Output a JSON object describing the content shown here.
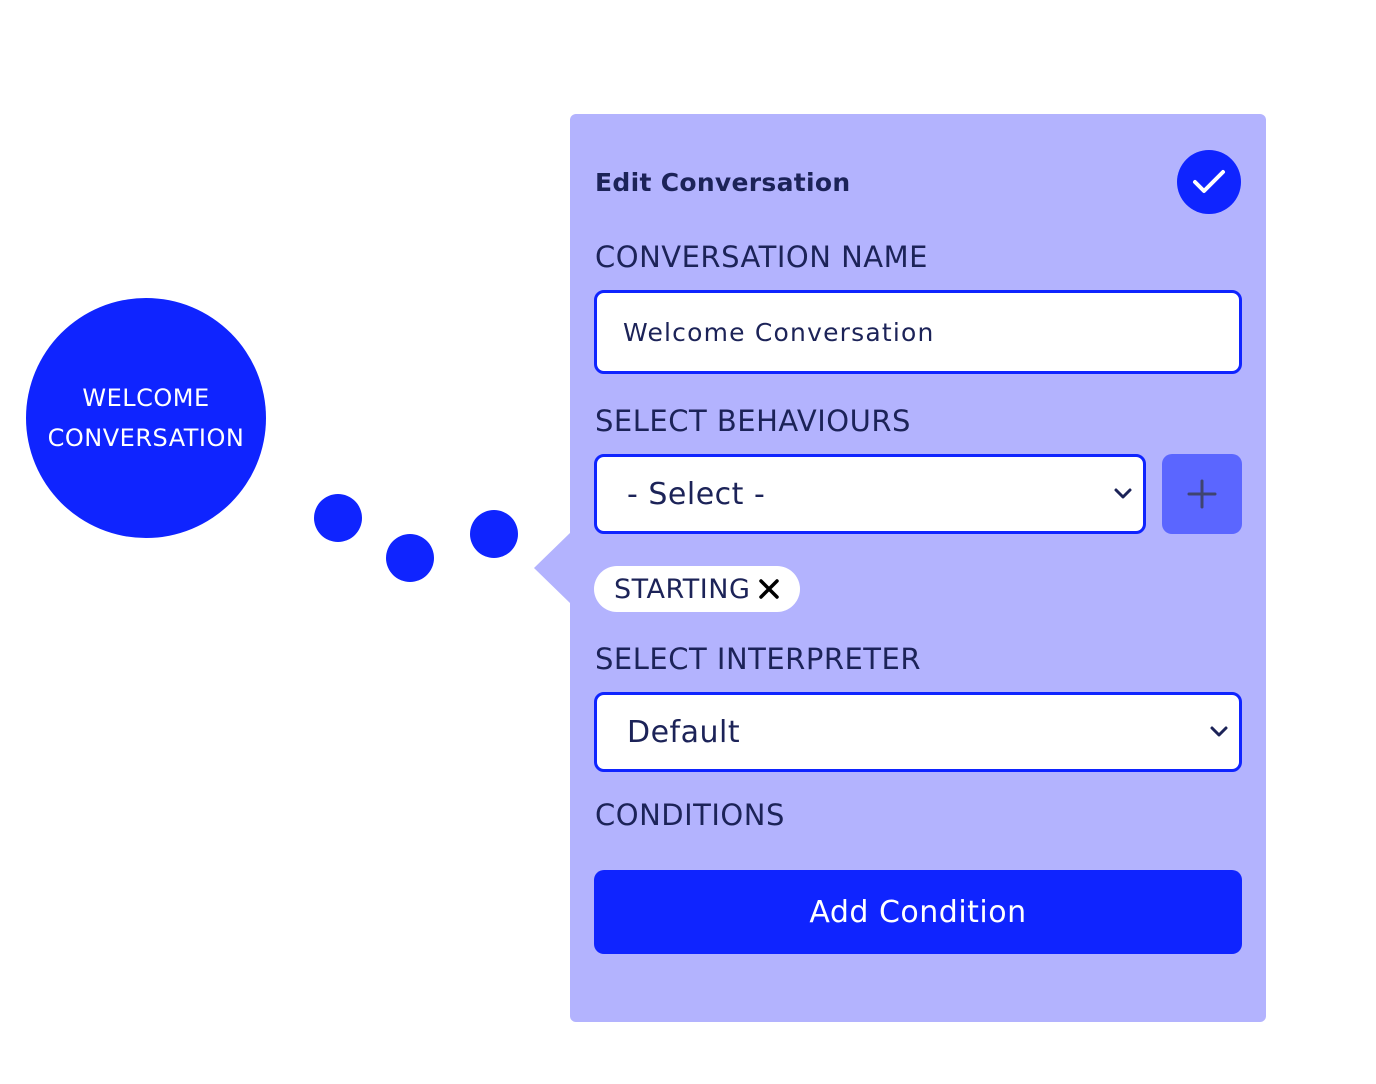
{
  "node": {
    "line1": "WELCOME",
    "line2": "CONVERSATION"
  },
  "panel": {
    "title": "Edit Conversation",
    "confirm_icon": "checkmark-icon",
    "name_label": "CONVERSATION NAME",
    "name_value": "Welcome Conversation",
    "behaviours_label": "SELECT BEHAVIOURS",
    "behaviours_selected": "- Select -",
    "add_behaviour_icon": "plus-icon",
    "behaviour_tags": [
      {
        "label": "STARTING",
        "remove_icon": "close-icon"
      }
    ],
    "interpreter_label": "SELECT INTERPRETER",
    "interpreter_selected": "Default",
    "conditions_label": "CONDITIONS",
    "add_condition_label": "Add Condition"
  },
  "colors": {
    "accent": "#0f24ff",
    "panel_bg": "#b3b3fe",
    "plus_button_bg": "#5b66ff",
    "text_dark": "#1c2358",
    "white": "#ffffff"
  }
}
